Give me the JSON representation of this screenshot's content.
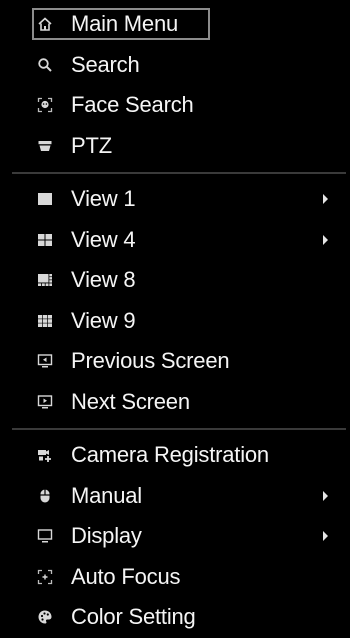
{
  "menu": {
    "groups": [
      [
        {
          "label": "Main Menu",
          "icon": "home-icon"
        },
        {
          "label": "Search",
          "icon": "search-icon"
        },
        {
          "label": "Face Search",
          "icon": "face-search-icon"
        },
        {
          "label": "PTZ",
          "icon": "ptz-camera-icon"
        }
      ],
      [
        {
          "label": "View 1",
          "icon": "view-1-icon"
        },
        {
          "label": "View 4",
          "icon": "view-4-icon"
        },
        {
          "label": "View 8",
          "icon": "view-8-icon"
        },
        {
          "label": "View 9",
          "icon": "view-9-icon"
        },
        {
          "label": "Previous Screen",
          "icon": "previous-screen-icon"
        },
        {
          "label": "Next Screen",
          "icon": "next-screen-icon"
        }
      ],
      [
        {
          "label": "Camera Registration",
          "icon": "camera-registration-icon"
        },
        {
          "label": "Manual",
          "icon": "manual-record-icon"
        },
        {
          "label": "Display",
          "icon": "display-monitor-icon"
        },
        {
          "label": "Auto Focus",
          "icon": "auto-focus-icon"
        },
        {
          "label": "Color Setting",
          "icon": "color-palette-icon"
        }
      ]
    ]
  },
  "colors": {
    "background": "#000000",
    "text": "#f5f5f5",
    "separator": "#3a3a3a",
    "selection_border": "#8c8c8c"
  }
}
